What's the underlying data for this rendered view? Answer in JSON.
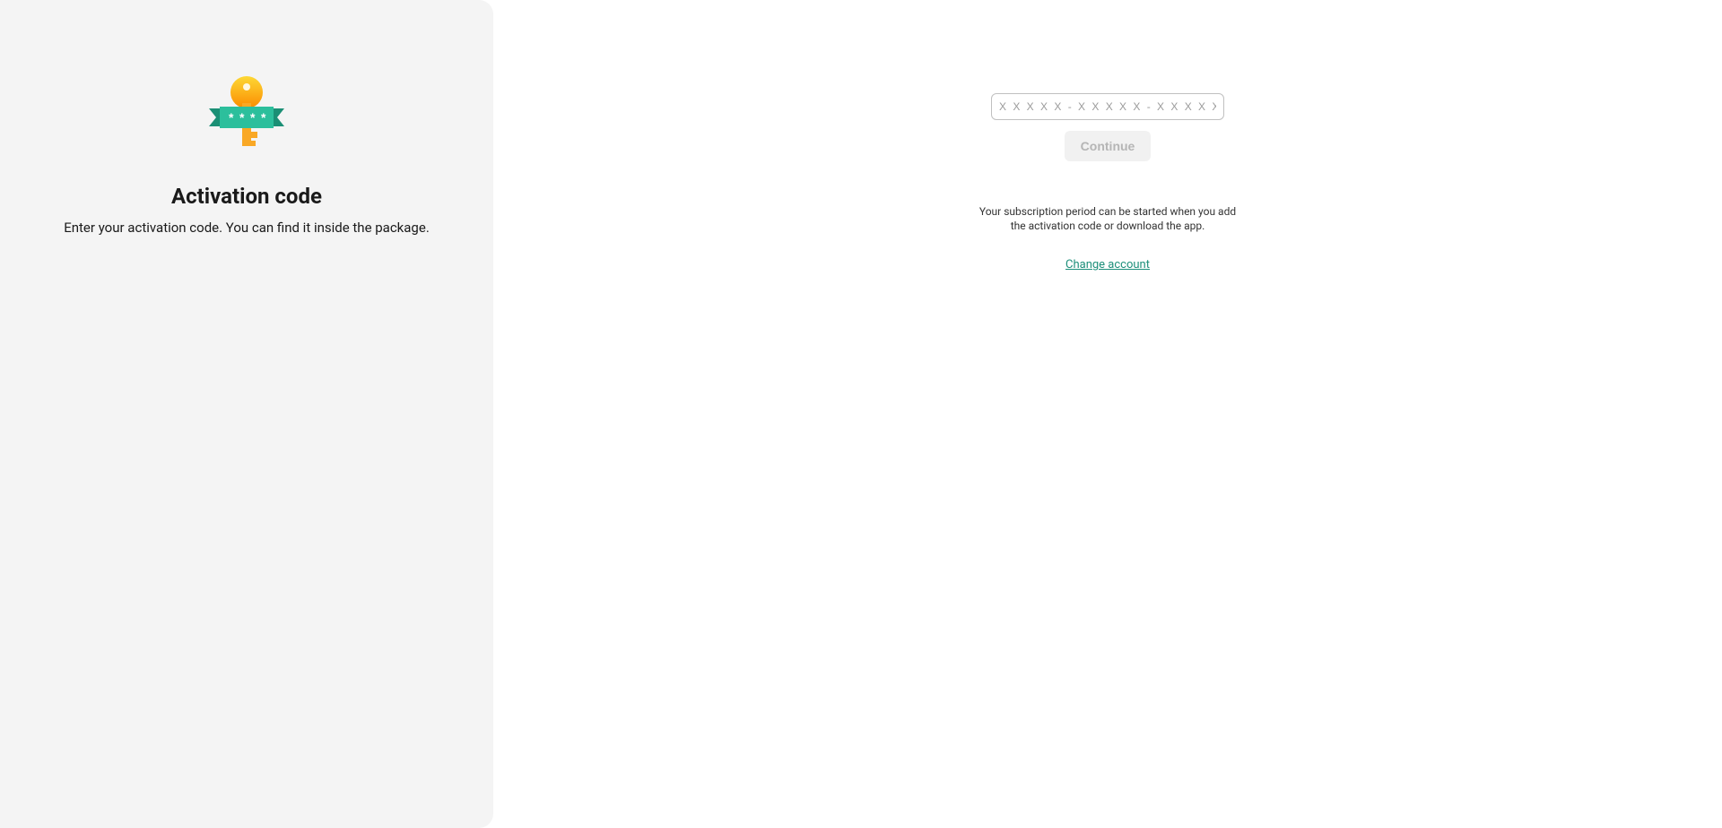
{
  "left": {
    "heading": "Activation code",
    "subheading": "Enter your activation code. You can find it inside the package."
  },
  "right": {
    "placeholder": "X X X X X - X X X X X - X X X X X - X X X X X",
    "continue_label": "Continue",
    "info_text": "Your subscription period can be started when you add the activation code or download the app.",
    "change_account_label": "Change account"
  }
}
